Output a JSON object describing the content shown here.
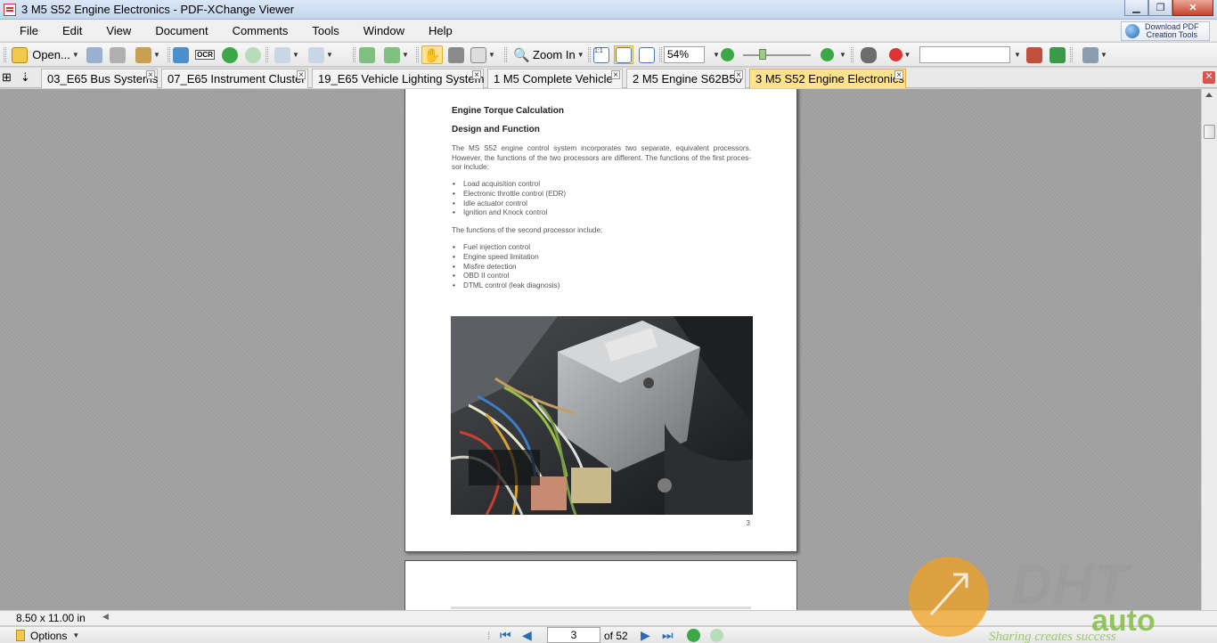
{
  "window": {
    "title": "3 M5 S52 Engine Electronics - PDF-XChange Viewer"
  },
  "menu": [
    "File",
    "Edit",
    "View",
    "Document",
    "Comments",
    "Tools",
    "Window",
    "Help"
  ],
  "download_button": {
    "line1": "Download PDF",
    "line2": "Creation Tools"
  },
  "toolbar": {
    "open_label": "Open...",
    "zoom_in_label": "Zoom In",
    "zoom_value": "54%",
    "ocr_label": "OCR"
  },
  "tabs": [
    {
      "label": "03_E65 Bus Systems",
      "active": false
    },
    {
      "label": "07_E65 Instrument Cluster",
      "active": false
    },
    {
      "label": "19_E65 Vehicle Lighting System",
      "active": false
    },
    {
      "label": "1 M5 Complete Vehicle",
      "active": false
    },
    {
      "label": "2 M5 Engine S62B50",
      "active": false
    },
    {
      "label": "3 M5 S52 Engine Electronics",
      "active": true
    }
  ],
  "document": {
    "heading1": "Engine Torque Calculation",
    "heading2": "Design and Function",
    "para1": "The MS S52 engine control system incorporates two separate, equivalent processors. However, the functions of the two processors are different. The functions of the first proces-sor include:",
    "list1": [
      "Load acquisition control",
      "Electronic throttle control (EDR)",
      "Idle actuator control",
      "Ignition and Knock control"
    ],
    "para2": "The functions of the second processor include:",
    "list2": [
      "Fuel injection control",
      "Engine speed limitation",
      "Misfire detection",
      "OBD II control",
      "DTML control (leak diagnosis)"
    ],
    "page_number": "3"
  },
  "status": {
    "page_size": "8.50 x 11.00 in"
  },
  "nav": {
    "options_label": "Options",
    "current_page": "3",
    "total_pages": "of 52"
  },
  "watermark": {
    "text1": "DHT",
    "text2": "auto",
    "tagline": "Sharing creates success"
  }
}
